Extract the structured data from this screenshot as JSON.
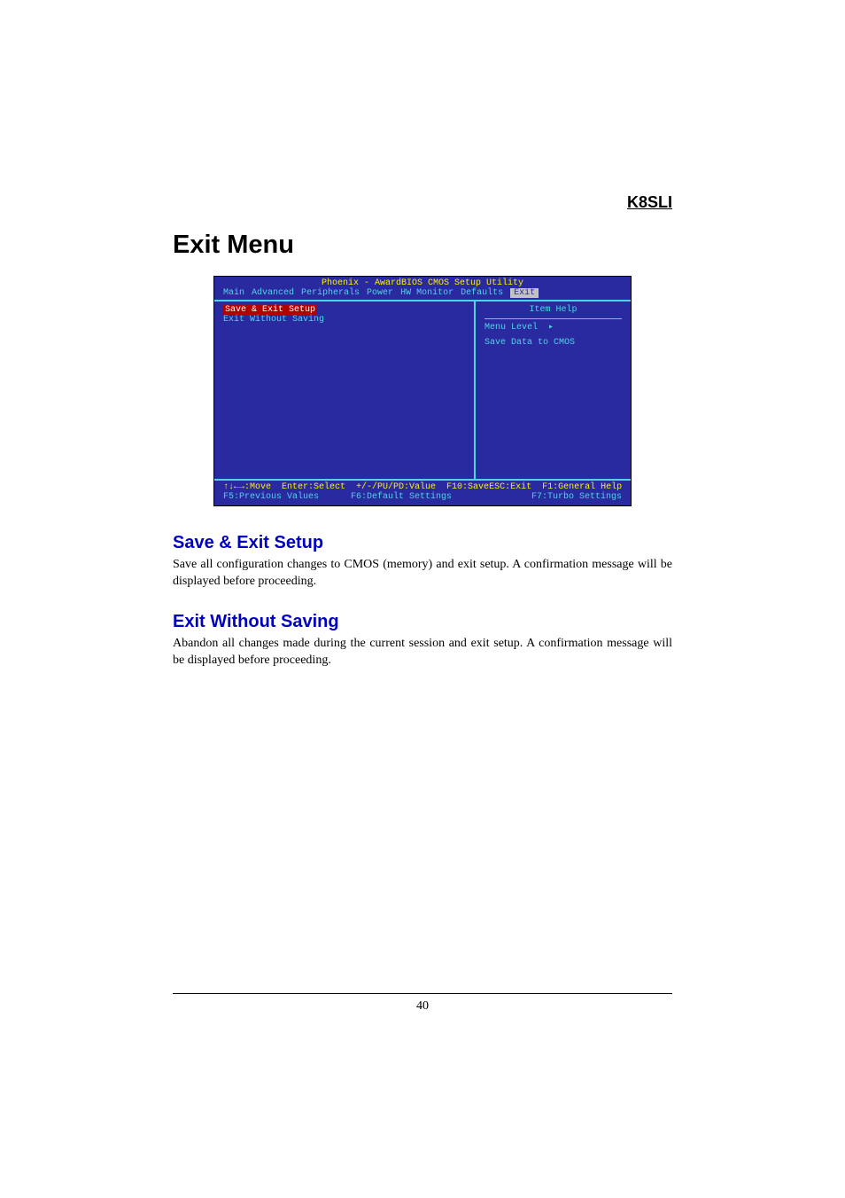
{
  "header": {
    "model": "K8SLI"
  },
  "title": "Exit Menu",
  "bios": {
    "title": "Phoenix - AwardBIOS CMOS Setup Utility",
    "tabs": [
      "Main",
      "Advanced",
      "Peripherals",
      "Power",
      "HW Monitor",
      "Defaults",
      "Exit"
    ],
    "active_tab": "Exit",
    "menu_items": {
      "selected": "Save & Exit Setup",
      "others": [
        "Exit Without Saving"
      ]
    },
    "help": {
      "title": "Item Help",
      "level_label": "Menu Level",
      "level_marker": "▸",
      "desc": "Save Data to CMOS"
    },
    "footer": {
      "row1_left": "↑↓←→:Move  Enter:Select  +/-/PU/PD:Value  F10:Save",
      "row1_right": "ESC:Exit  F1:General Help",
      "row2_left": "F5:Previous Values      F6:Default Settings",
      "row2_right": "F7:Turbo Settings"
    }
  },
  "sections": [
    {
      "heading": "Save & Exit Setup",
      "body": "Save all configuration changes to CMOS (memory) and exit setup. A confirmation message will be displayed before proceeding."
    },
    {
      "heading": "Exit Without Saving",
      "body": "Abandon all changes made during the current session and exit setup. A confirmation message will be displayed before proceeding."
    }
  ],
  "page_number": "40"
}
